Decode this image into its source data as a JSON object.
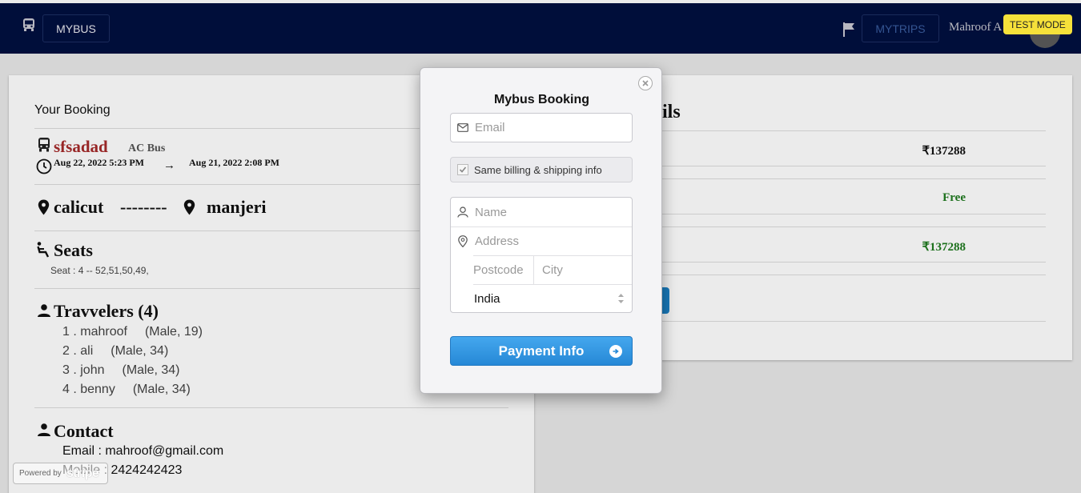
{
  "navbar": {
    "brand": "MYBUS",
    "trips": "MYTRIPS",
    "user": "Mahroof A",
    "test_mode": "TEST MODE"
  },
  "booking": {
    "title": "Your Booking",
    "bus_name": "sfsadad",
    "bus_type": "AC Bus",
    "departure": "Aug 22, 2022 5:23 PM",
    "arrow": "→",
    "arrival": "Aug 21, 2022 2:08 PM",
    "from": "calicut",
    "dashes": "--------",
    "to": "manjeri",
    "seats_title": "Seats",
    "seats_line": "Seat : 4 -- 52,51,50,49,",
    "travellers_title": "Travvelers (4)",
    "travellers": [
      {
        "label": "1 . mahroof",
        "info": "(Male, 19)"
      },
      {
        "label": "2 . ali",
        "info": "(Male, 34)"
      },
      {
        "label": "3 . john",
        "info": "(Male, 34)"
      },
      {
        "label": "4 . benny",
        "info": "(Male, 34)"
      }
    ],
    "contact_title": "Contact",
    "email_line": "Email : mahroof@gmail.com",
    "mobile_line": "Mobile : 2424242423"
  },
  "details": {
    "title_partial": "ails",
    "total": "₹137288",
    "fee": "Free",
    "grand_total": "₹137288"
  },
  "modal": {
    "title": "Mybus Booking",
    "email_placeholder": "Email",
    "same_billing": "Same billing & shipping info",
    "name_placeholder": "Name",
    "address_placeholder": "Address",
    "postcode_placeholder": "Postcode",
    "city_placeholder": "City",
    "country": "India",
    "pay_button": "Payment Info"
  },
  "stripe": {
    "powered_by": "Powered by",
    "brand": "stripe"
  }
}
